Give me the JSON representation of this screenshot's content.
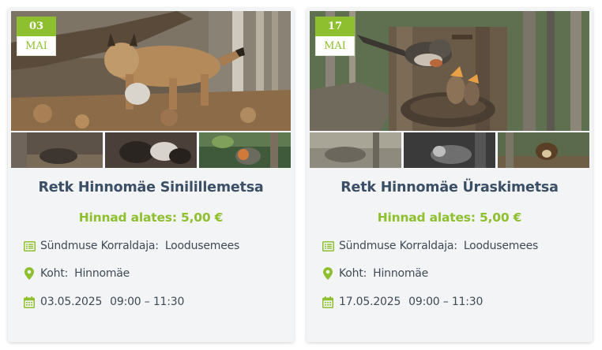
{
  "colors": {
    "accent": "#8dbf2f",
    "title": "#3b4f66",
    "text": "#3e4a57",
    "card_bg": "#f3f4f5"
  },
  "events": [
    {
      "day": "03",
      "month": "MAI",
      "title": "Retk Hinnomäe Sinilillemetsa",
      "price": "Hinnad alates: 5,00 €",
      "organizer_label": "Sündmuse Korraldaja:",
      "organizer": "Loodusemees",
      "place_label": "Koht:",
      "place": "Hinnomäe",
      "date": "03.05.2025",
      "time": "09:00 – 11:30",
      "icons": [
        "list-icon",
        "map-pin-icon",
        "calendar-icon"
      ]
    },
    {
      "day": "17",
      "month": "MAI",
      "title": "Retk Hinnomäe Üraskimetsa",
      "price": "Hinnad alates: 5,00 €",
      "organizer_label": "Sündmuse Korraldaja:",
      "organizer": "Loodusemees",
      "place_label": "Koht:",
      "place": "Hinnomäe",
      "date": "17.05.2025",
      "time": "09:00 – 11:30",
      "icons": [
        "list-icon",
        "map-pin-icon",
        "calendar-icon"
      ]
    }
  ]
}
